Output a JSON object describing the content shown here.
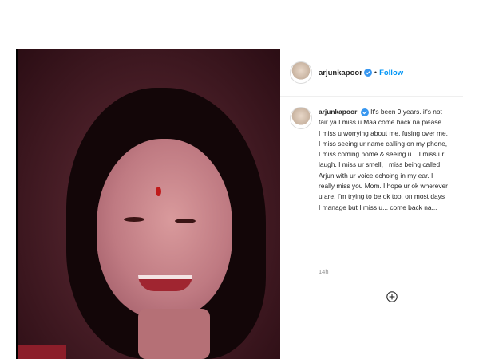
{
  "post": {
    "username": "arjunkapoor",
    "follow_label": "Follow",
    "separator": "•",
    "caption": "It's been 9 years. it's not fair ya I miss u Maa come back na please... I miss u worrying about me, fusing over me, I miss seeing ur name calling on my phone, I miss coming home & seeing u... I miss ur laugh. I miss ur smell, I miss being called Arjun with ur voice echoing in my ear. I really miss you Mom. I hope ur ok wherever u are, I'm trying to be ok too. on most days I manage but I miss u... come back na...",
    "timestamp": "14h",
    "verified_color": "#3897f0",
    "follow_color": "#0095f6",
    "icons": {
      "verified": "verified-badge-icon",
      "add_comment": "add-comment-icon"
    }
  }
}
